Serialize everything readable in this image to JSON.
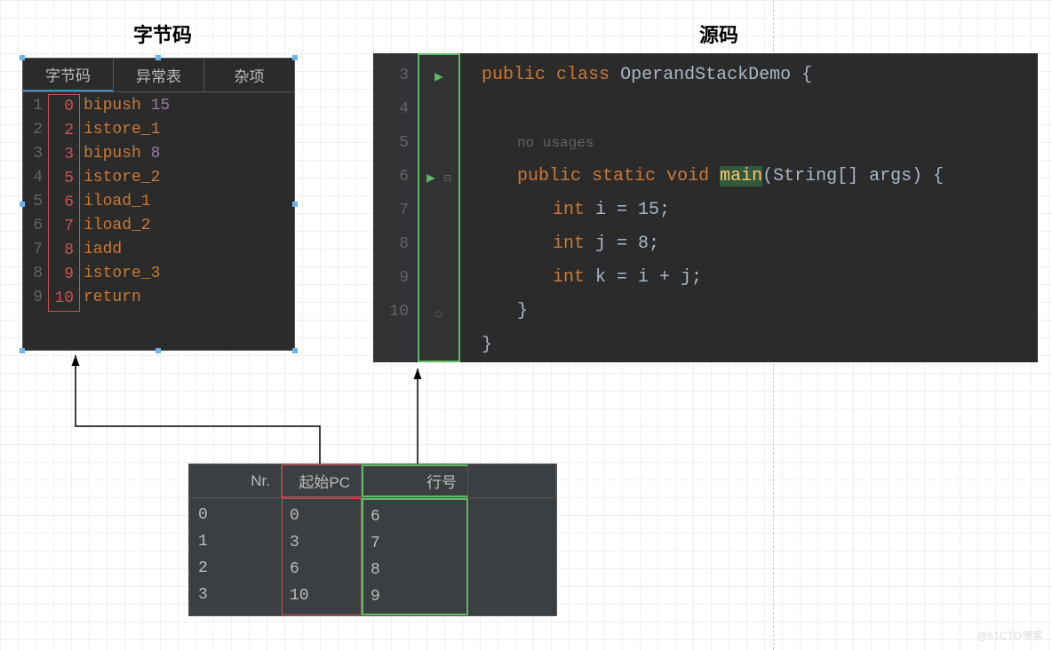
{
  "titles": {
    "bytecode": "字节码",
    "source": "源码"
  },
  "tabs": {
    "bytecode": "字节码",
    "exception": "异常表",
    "misc": "杂项"
  },
  "bytecode": {
    "lines": [
      {
        "n": "1",
        "pc": "0",
        "instr": "bipush",
        "arg": "15"
      },
      {
        "n": "2",
        "pc": "2",
        "instr": "istore_1",
        "arg": ""
      },
      {
        "n": "3",
        "pc": "3",
        "instr": "bipush",
        "arg": "8"
      },
      {
        "n": "4",
        "pc": "5",
        "instr": "istore_2",
        "arg": ""
      },
      {
        "n": "5",
        "pc": "6",
        "instr": "iload_1",
        "arg": ""
      },
      {
        "n": "6",
        "pc": "7",
        "instr": "iload_2",
        "arg": ""
      },
      {
        "n": "7",
        "pc": "8",
        "instr": "iadd",
        "arg": ""
      },
      {
        "n": "8",
        "pc": "9",
        "instr": "istore_3",
        "arg": ""
      },
      {
        "n": "9",
        "pc": "10",
        "instr": "return",
        "arg": ""
      }
    ]
  },
  "source": {
    "gutter": [
      "3",
      "4",
      "",
      "5",
      "6",
      "7",
      "8",
      "9",
      "10"
    ],
    "line3": {
      "kw1": "public",
      "kw2": "class",
      "cls": "OperandStackDemo",
      "brace": "{"
    },
    "usages": "no usages",
    "line5": {
      "kw1": "public",
      "kw2": "static",
      "kw3": "void",
      "name": "main",
      "args": "(String[] args) {"
    },
    "line6": {
      "kw": "int",
      "rest": " i = ",
      "val": "15",
      "semi": ";"
    },
    "line7": {
      "kw": "int",
      "rest": " j = ",
      "val": "8",
      "semi": ";"
    },
    "line8": {
      "kw": "int",
      "rest": " k = i + j;"
    },
    "close1": "}",
    "close2": "}"
  },
  "table": {
    "headers": {
      "nr": "Nr.",
      "pc": "起始PC",
      "line": "行号"
    },
    "rows": [
      {
        "nr": "0",
        "pc": "0",
        "line": "6"
      },
      {
        "nr": "1",
        "pc": "3",
        "line": "7"
      },
      {
        "nr": "2",
        "pc": "6",
        "line": "8"
      },
      {
        "nr": "3",
        "pc": "10",
        "line": "9"
      }
    ]
  },
  "watermark": "@51CTO博客"
}
